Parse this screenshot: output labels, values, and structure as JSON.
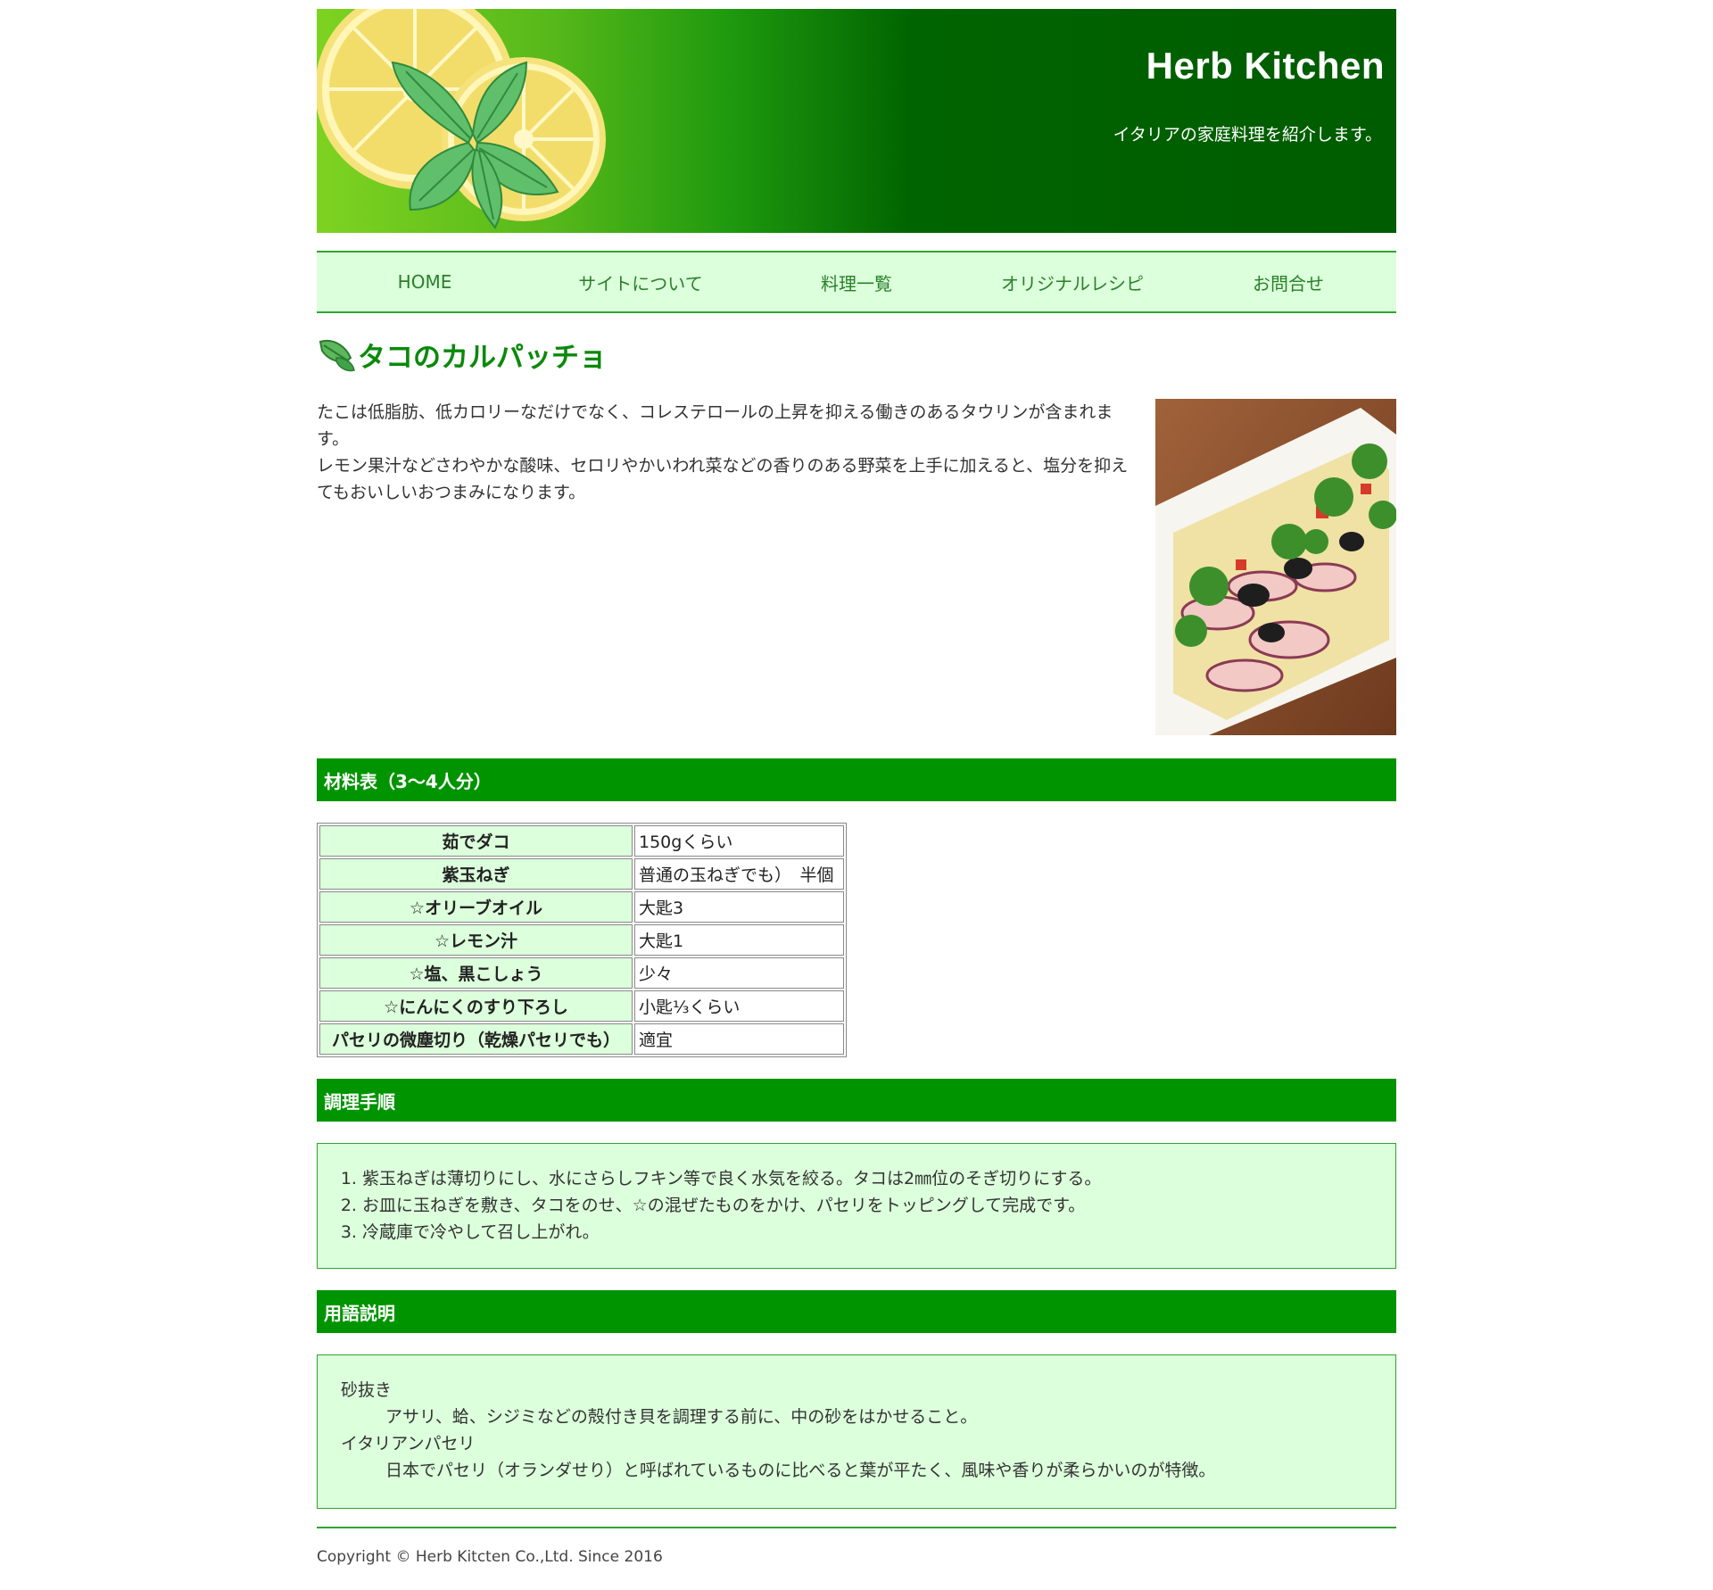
{
  "header": {
    "site_title": "Herb Kitchen",
    "tagline": "イタリアの家庭料理を紹介します。"
  },
  "nav": {
    "items": [
      "HOME",
      "サイトについて",
      "料理一覧",
      "オリジナルレシピ",
      "お問合せ"
    ]
  },
  "page": {
    "title": "タコのカルパッチョ",
    "intro": [
      "たこは低脂肪、低カロリーなだけでなく、コレステロールの上昇を抑える働きのあるタウリンが含まれます。",
      "レモン果汁などさわやかな酸味、セロリやかいわれ菜などの香りのある野菜を上手に加えると、塩分を抑えてもおいしいおつまみになります。"
    ]
  },
  "ingredients": {
    "heading": "材料表（3〜4人分）",
    "rows": [
      {
        "name": "茹でダコ",
        "amount": "150gくらい"
      },
      {
        "name": "紫玉ねぎ",
        "amount": "普通の玉ねぎでも）　半個"
      },
      {
        "name": "☆オリーブオイル",
        "amount": "大匙3"
      },
      {
        "name": "☆レモン汁",
        "amount": "大匙1"
      },
      {
        "name": "☆塩、黒こしょう",
        "amount": "少々"
      },
      {
        "name": "☆にんにくのすり下ろし",
        "amount": "小匙⅓くらい"
      },
      {
        "name": "パセリの微塵切り（乾燥パセリでも）",
        "amount": "適宜"
      }
    ]
  },
  "steps": {
    "heading": "調理手順",
    "items": [
      "紫玉ねぎは薄切りにし、水にさらしフキン等で良く水気を絞る。タコは2㎜位のそぎ切りにする。",
      "お皿に玉ねぎを敷き、タコをのせ、☆の混ぜたものをかけ、パセリをトッピングして完成です。",
      "冷蔵庫で冷やして召し上がれ。"
    ]
  },
  "glossary": {
    "heading": "用語説明",
    "terms": [
      {
        "term": "砂抜き",
        "desc": "アサリ、蛤、シジミなどの殻付き貝を調理する前に、中の砂をはかせること。"
      },
      {
        "term": "イタリアンパセリ",
        "desc": "日本でパセリ（オランダせり）と呼ばれているものに比べると葉が平たく、風味や香りが柔らかいのが特徴。"
      }
    ]
  },
  "footer": {
    "copyright": "Copyright © Herb Kitcten Co.,Ltd. Since 2016"
  },
  "colors": {
    "brand_green": "#009400",
    "light_green": "#dcffdc",
    "nav_text": "#2a7f2a",
    "title_green": "#0a8a0a"
  },
  "icons": {
    "title_icon": "leaf-icon",
    "header_art": "lemon-mint-image",
    "dish_photo": "octopus-carpaccio-photo"
  }
}
